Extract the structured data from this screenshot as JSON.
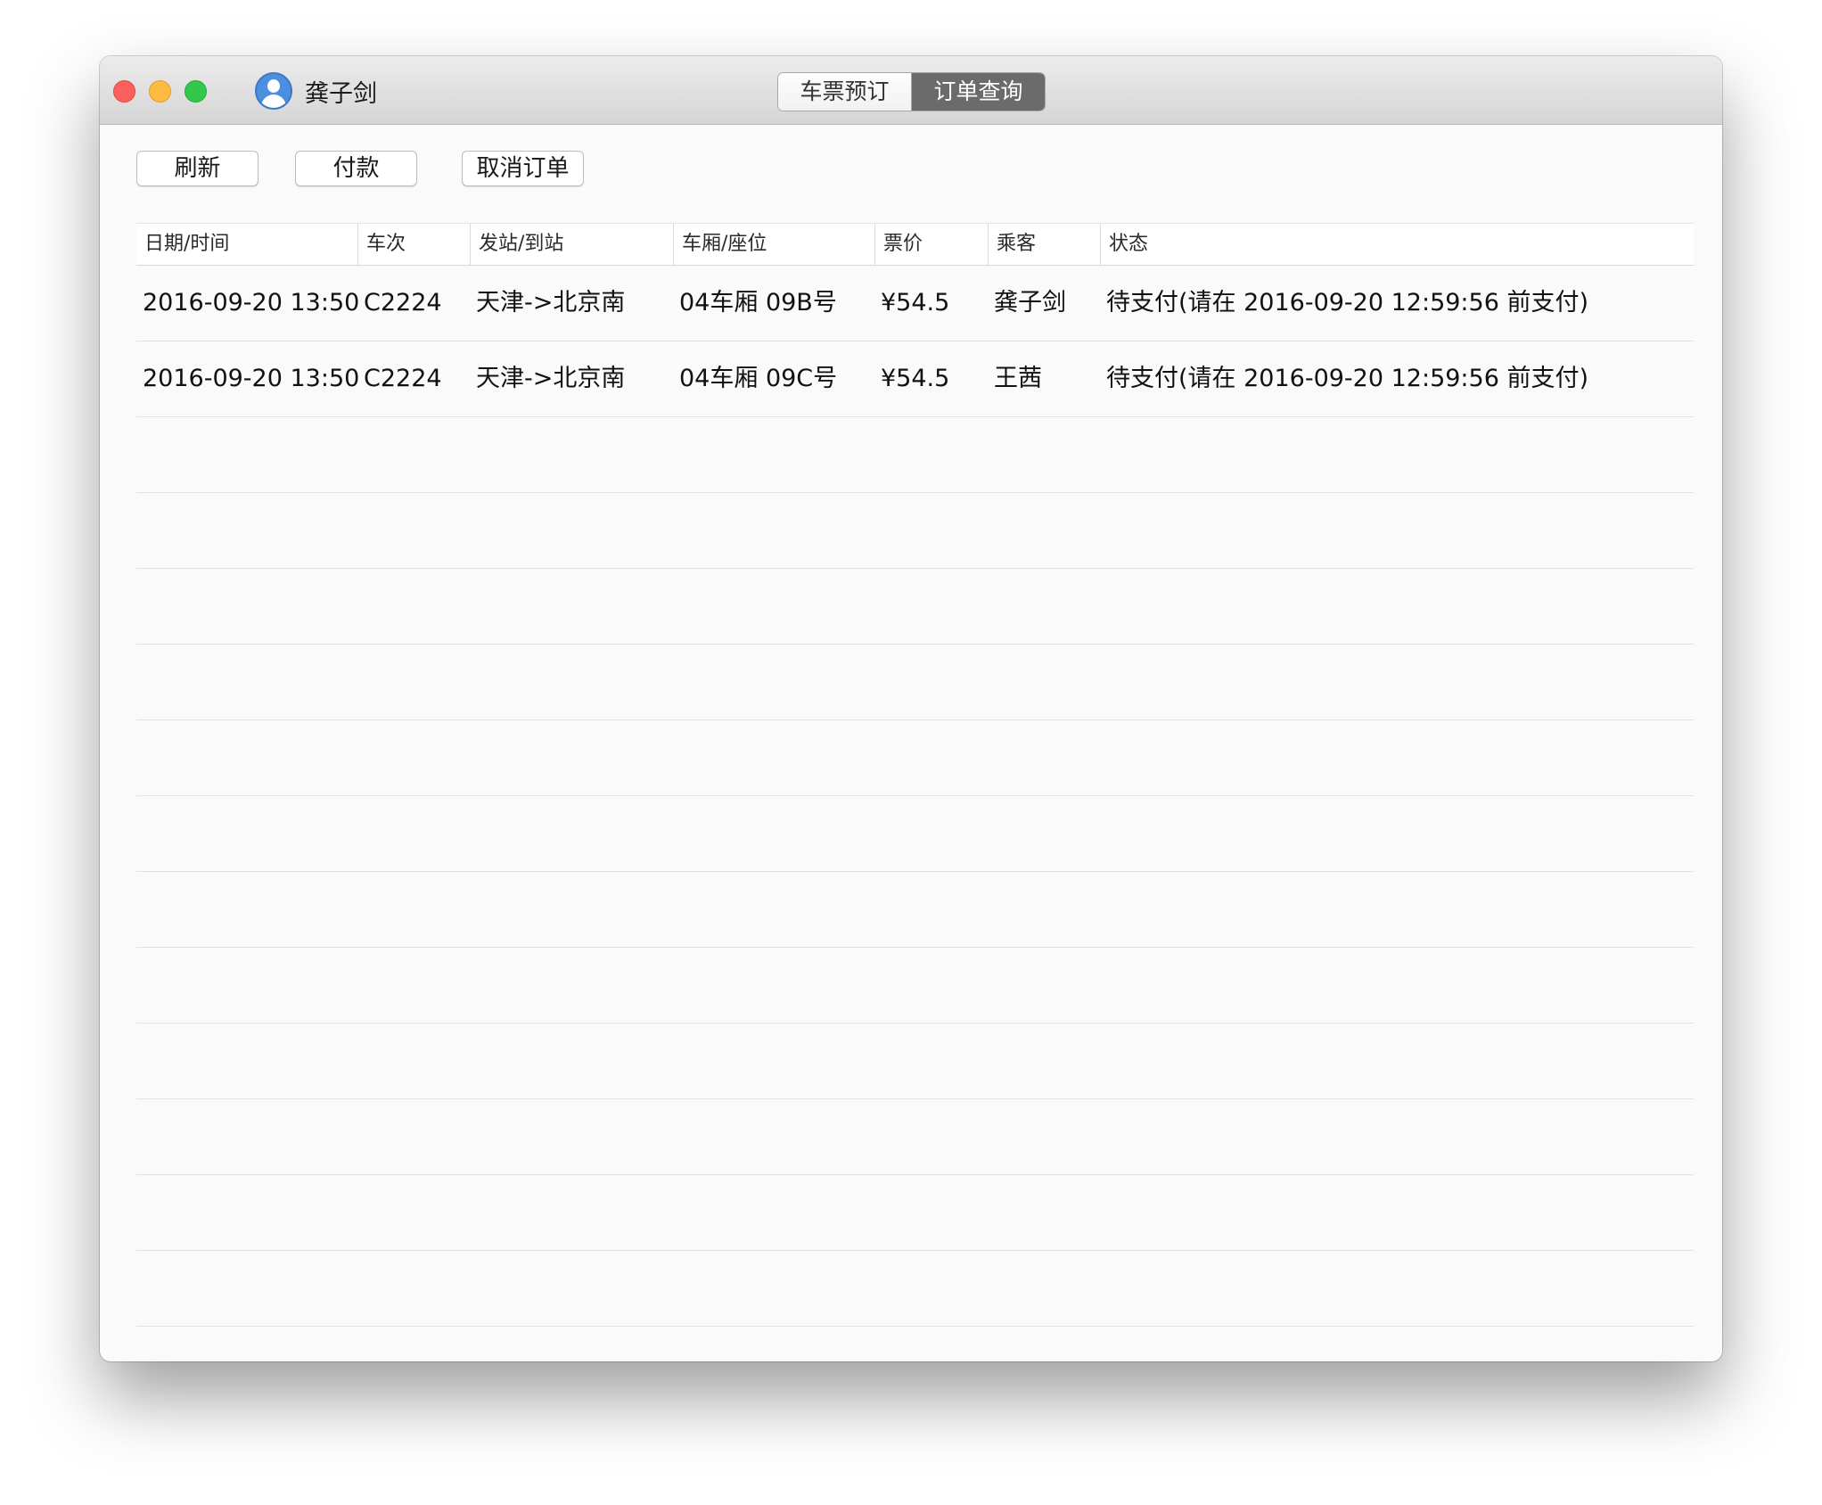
{
  "window": {
    "user_name": "龚子剑",
    "tabs": [
      {
        "label": "车票预订",
        "active": false
      },
      {
        "label": "订单查询",
        "active": true
      }
    ]
  },
  "toolbar": {
    "refresh_label": "刷新",
    "pay_label": "付款",
    "cancel_label": "取消订单"
  },
  "table": {
    "columns": [
      "日期/时间",
      "车次",
      "发站/到站",
      "车厢/座位",
      "票价",
      "乘客",
      "状态"
    ],
    "rows": [
      {
        "datetime": "2016-09-20 13:50",
        "train": "C2224",
        "route": "天津->北京南",
        "seat": "04车厢 09B号",
        "price": "¥54.5",
        "passenger": "龚子剑",
        "status": "待支付(请在 2016-09-20 12:59:56 前支付)"
      },
      {
        "datetime": "2016-09-20 13:50",
        "train": "C2224",
        "route": "天津->北京南",
        "seat": "04车厢 09C号",
        "price": "¥54.5",
        "passenger": "王茜",
        "status": "待支付(请在 2016-09-20 12:59:56 前支付)"
      }
    ]
  },
  "colors": {
    "active_tab_bg": "#6b6b6b",
    "close": "#fc605c",
    "minimize": "#fdbc40",
    "maximize": "#34c84a",
    "avatar": "#4a8fe0"
  }
}
